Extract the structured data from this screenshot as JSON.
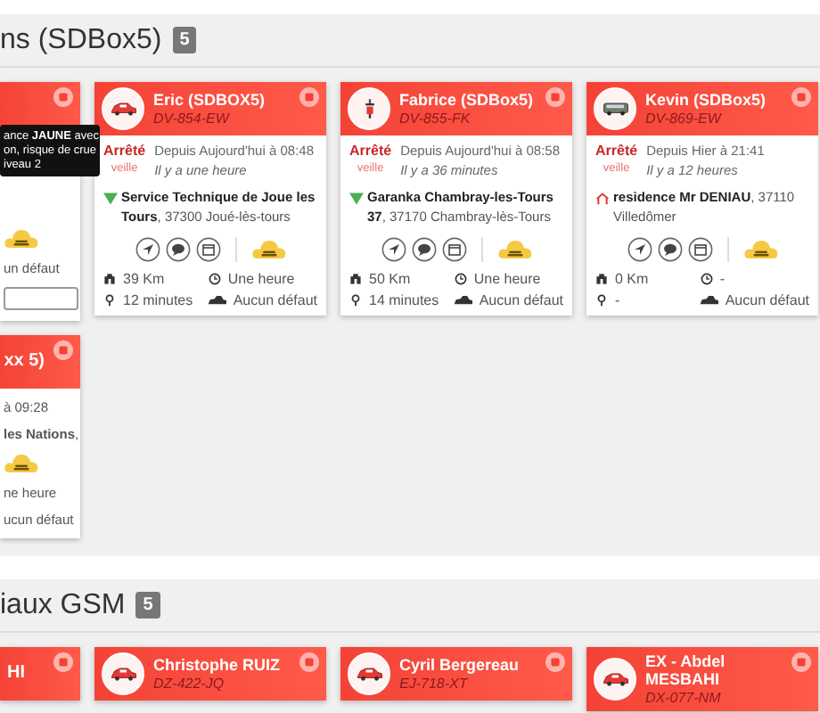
{
  "sections": [
    {
      "title": "ns (SDBox5)",
      "count": "5",
      "cards": [
        {
          "kind": "clipped",
          "tooltip": [
            "ance **JAUNE** avec",
            "on, risque de crue",
            "iveau 2"
          ],
          "lines": [
            "un défaut"
          ],
          "has_field": true,
          "weather": true
        },
        {
          "kind": "full",
          "vehicle": {
            "kind": "car"
          },
          "name": "Eric (SDBOX5)",
          "plate": "DV-854-EW",
          "status": "Arrêté",
          "substatus": "veille",
          "since": "Depuis Aujourd'hui à 08:48",
          "ago": "Il y a une heure",
          "place_icon": {
            "kind": "gps"
          },
          "place": "**Service Technique de Joue les Tours**, 37300 Joué-lès-tours",
          "distance": "39 Km",
          "time": "Une heure",
          "duration": "12 minutes",
          "defects": "Aucun défaut"
        },
        {
          "kind": "full",
          "vehicle": {
            "kind": "scooter"
          },
          "name": "Fabrice (SDBox5)",
          "plate": "DV-855-FK",
          "status": "Arrêté",
          "substatus": "veille",
          "since": "Depuis Aujourd'hui à 08:58",
          "ago": "Il y a 36 minutes",
          "place_icon": {
            "kind": "gps"
          },
          "place": "**Garanka Chambray-les-Tours 37**, 37170 Chambray-lès-Tours",
          "distance": "50 Km",
          "time": "Une heure",
          "duration": "14 minutes",
          "defects": "Aucun défaut"
        },
        {
          "kind": "full",
          "vehicle": {
            "kind": "bus"
          },
          "name": "Kevin (SDBox5)",
          "plate": "DV-869-EW",
          "status": "Arrêté",
          "substatus": "veille",
          "since": "Depuis Hier à 21:41",
          "ago": "Il y a 12 heures",
          "place_icon": {
            "kind": "home"
          },
          "place": "**residence Mr DENIAU**, 37110 Villedômer",
          "distance": "0 Km",
          "time": "-",
          "duration": "-",
          "defects": "Aucun défaut"
        },
        {
          "kind": "clipped",
          "header": "xx 5)",
          "lines": [
            "à 09:28",
            "**les Nations**,"
          ],
          "weather": true,
          "tail": [
            "ne heure",
            "ucun défaut"
          ]
        }
      ]
    },
    {
      "title": "iaux GSM",
      "count": "5",
      "cards": [
        {
          "kind": "clipped",
          "header": "HI"
        },
        {
          "kind": "full",
          "vehicle": {
            "kind": "car"
          },
          "name": "Christophe RUIZ",
          "plate": "DZ-422-JQ"
        },
        {
          "kind": "full",
          "vehicle": {
            "kind": "car"
          },
          "name": "Cyril Bergereau",
          "plate": "EJ-718-XT"
        },
        {
          "kind": "full",
          "vehicle": {
            "kind": "car"
          },
          "name": "EX - Abdel MESBAHI",
          "plate": "DX-077-NM"
        }
      ]
    }
  ]
}
